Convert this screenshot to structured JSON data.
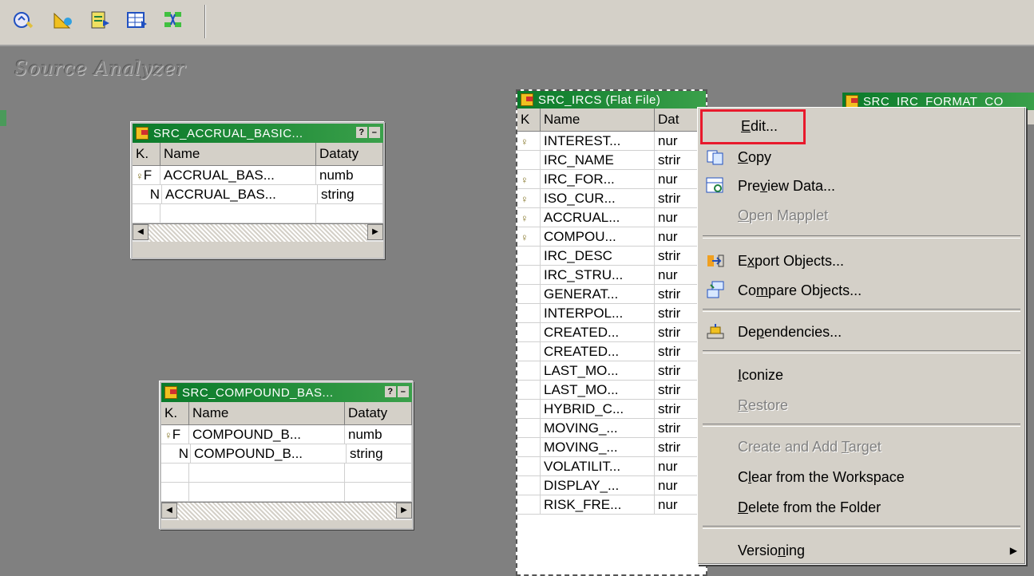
{
  "workspace_title": "Source Analyzer",
  "toolbar": {
    "buttons": [
      {
        "icon": "source-analyzer-icon"
      },
      {
        "icon": "target-designer-icon"
      },
      {
        "icon": "transformation-developer-icon"
      },
      {
        "icon": "mapplet-designer-icon"
      },
      {
        "icon": "mapping-designer-icon"
      }
    ]
  },
  "tables": {
    "accrual": {
      "title": "SRC_ACCRUAL_BASIC...",
      "headers": [
        "K.",
        "Name",
        "Dataty"
      ],
      "rows": [
        {
          "k": "F",
          "name": "ACCRUAL_BAS...",
          "type": "numb"
        },
        {
          "k": "N",
          "name": "ACCRUAL_BAS...",
          "type": "string"
        }
      ]
    },
    "compound": {
      "title": "SRC_COMPOUND_BAS...",
      "headers": [
        "K.",
        "Name",
        "Dataty"
      ],
      "rows": [
        {
          "k": "F",
          "name": "COMPOUND_B...",
          "type": "numb"
        },
        {
          "k": "N",
          "name": "COMPOUND_B...",
          "type": "string"
        }
      ]
    },
    "ircs": {
      "title": "SRC_IRCS (Flat File)",
      "headers": [
        "K",
        "Name",
        "Dat"
      ],
      "rows": [
        {
          "name": "INTEREST...",
          "type": "nur",
          "key": true
        },
        {
          "name": "IRC_NAME",
          "type": "strir",
          "key": false
        },
        {
          "name": "IRC_FOR...",
          "type": "nur",
          "key": true
        },
        {
          "name": "ISO_CUR...",
          "type": "strir",
          "key": true
        },
        {
          "name": "ACCRUAL...",
          "type": "nur",
          "key": true
        },
        {
          "name": "COMPOU...",
          "type": "nur",
          "key": true
        },
        {
          "name": "IRC_DESC",
          "type": "strir",
          "key": false
        },
        {
          "name": "IRC_STRU...",
          "type": "nur",
          "key": false
        },
        {
          "name": "GENERAT...",
          "type": "strir",
          "key": false
        },
        {
          "name": "INTERPOL...",
          "type": "strir",
          "key": false
        },
        {
          "name": "CREATED...",
          "type": "strir",
          "key": false
        },
        {
          "name": "CREATED...",
          "type": "strir",
          "key": false
        },
        {
          "name": "LAST_MO...",
          "type": "strir",
          "key": false
        },
        {
          "name": "LAST_MO...",
          "type": "strir",
          "key": false
        },
        {
          "name": "HYBRID_C...",
          "type": "strir",
          "key": false
        },
        {
          "name": "MOVING_...",
          "type": "strir",
          "key": false
        },
        {
          "name": "MOVING_...",
          "type": "strir",
          "key": false
        },
        {
          "name": "VOLATILIT...",
          "type": "nur",
          "key": false
        },
        {
          "name": "DISPLAY_...",
          "type": "nur",
          "key": false
        },
        {
          "name": "RISK_FRE...",
          "type": "nur",
          "key": false
        }
      ]
    },
    "right_partial_title": "SRC_IRC_FORMAT_CO"
  },
  "context_menu": {
    "items": [
      {
        "label": "Edit...",
        "enabled": true,
        "icon": "",
        "highlighted": true
      },
      {
        "label": "Copy",
        "enabled": true,
        "icon": "copy-icon"
      },
      {
        "label": "Preview Data...",
        "enabled": true,
        "icon": "preview-data-icon"
      },
      {
        "label": "Open Mapplet",
        "enabled": false,
        "icon": ""
      },
      {
        "label": "Export Objects...",
        "enabled": true,
        "icon": "export-objects-icon"
      },
      {
        "label": "Compare Objects...",
        "enabled": true,
        "icon": "compare-objects-icon"
      },
      {
        "label": "Dependencies...",
        "enabled": true,
        "icon": "dependencies-icon"
      },
      {
        "label": "Iconize",
        "enabled": true,
        "icon": ""
      },
      {
        "label": "Restore",
        "enabled": false,
        "icon": ""
      },
      {
        "label": "Create and Add Target",
        "enabled": false,
        "icon": ""
      },
      {
        "label": "Clear from the Workspace",
        "enabled": true,
        "icon": ""
      },
      {
        "label": "Delete from the Folder",
        "enabled": true,
        "icon": ""
      },
      {
        "label": "Versioning",
        "enabled": true,
        "icon": "",
        "submenu": true
      }
    ]
  },
  "colors": {
    "title_bar": "#0a7a2a",
    "highlight_box": "#e8192c",
    "workspace": "#808080"
  }
}
